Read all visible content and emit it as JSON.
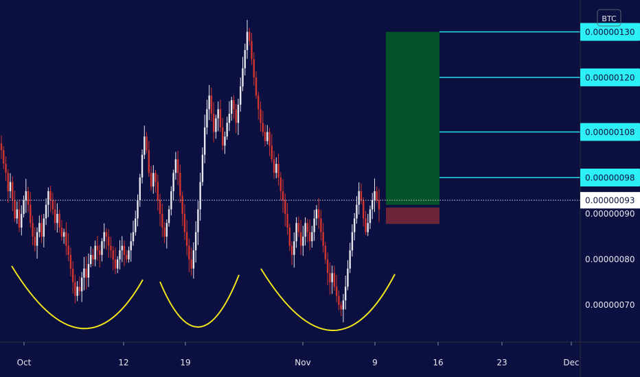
{
  "chart_data": {
    "type": "candlestick",
    "currency": "BTC",
    "y_ticks": [
      "0.00000090",
      "0.00000080",
      "0.00000070"
    ],
    "y_ticks_values": [
      9e-07,
      8e-07,
      7e-07
    ],
    "x_ticks": [
      "Oct",
      "12",
      "19",
      "Nov",
      "9",
      "16",
      "23",
      "Dec"
    ],
    "ylim": [
      6.2e-07,
      1.37e-06
    ],
    "current_price": {
      "label": "0.00000093",
      "value": 9.3e-07
    },
    "targets": [
      {
        "label": "0.00000130",
        "value": 1.3e-06
      },
      {
        "label": "0.00000120",
        "value": 1.2e-06
      },
      {
        "label": "0.00000108",
        "value": 1.08e-06
      },
      {
        "label": "0.00000098",
        "value": 9.8e-07
      }
    ],
    "position": {
      "profit_top": 1.3e-06,
      "entry": 9.2e-07,
      "stop": 8.78e-07
    },
    "colors": {
      "background": "#0b1040",
      "bull": "#e8e8ee",
      "bear": "#d2352f",
      "target_line": "#27e0f0",
      "target_fill": "#2cf0f6",
      "profit_zone": "#04522a",
      "loss_zone": "#6b2438",
      "arc": "#f2e61a",
      "axis_text": "#e6e8f0"
    },
    "closes": [
      1.04e-06,
      1.01e-06,
      9.9e-07,
      9.5e-07,
      9.7e-07,
      9.3e-07,
      8.9e-07,
      9.1e-07,
      8.7e-07,
      9e-07,
      9.3e-07,
      9.5e-07,
      9.2e-07,
      8.8e-07,
      8.5e-07,
      8.3e-07,
      8.6e-07,
      8.8e-07,
      8.5e-07,
      8.9e-07,
      9.2e-07,
      9.5e-07,
      9.3e-07,
      9.1e-07,
      8.8e-07,
      9e-07,
      8.7e-07,
      8.5e-07,
      8.6e-07,
      8.3e-07,
      8.1e-07,
      7.8e-07,
      7.5e-07,
      7.2e-07,
      7.4e-07,
      7.3e-07,
      7.6e-07,
      7.8e-07,
      7.6e-07,
      7.9e-07,
      8.1e-07,
      8e-07,
      8.3e-07,
      8.2e-07,
      8.1e-07,
      8.4e-07,
      8.6e-07,
      8.5e-07,
      8.3e-07,
      8.2e-07,
      8e-07,
      7.8e-07,
      8e-07,
      8.2e-07,
      8.3e-07,
      8.1e-07,
      8e-07,
      8.2e-07,
      8.4e-07,
      8.6e-07,
      8.9e-07,
      9.3e-07,
      9.8e-07,
      1.03e-06,
      1.07e-06,
      1.04e-06,
      9.9e-07,
      9.6e-07,
      9.9e-07,
      9.7e-07,
      9.3e-07,
      9e-07,
      8.7e-07,
      8.5e-07,
      8.8e-07,
      9.1e-07,
      9.5e-07,
      9.9e-07,
      1.02e-06,
      9.9e-07,
      9.4e-07,
      9e-07,
      8.6e-07,
      8.3e-07,
      8e-07,
      7.8e-07,
      8.2e-07,
      8.6e-07,
      9.1e-07,
      9.7e-07,
      1.03e-06,
      1.09e-06,
      1.13e-06,
      1.16e-06,
      1.12e-06,
      1.08e-06,
      1.11e-06,
      1.13e-06,
      1.09e-06,
      1.05e-06,
      1.07e-06,
      1.1e-06,
      1.12e-06,
      1.15e-06,
      1.13e-06,
      1.1e-06,
      1.14e-06,
      1.18e-06,
      1.22e-06,
      1.26e-06,
      1.3e-06,
      1.28e-06,
      1.24e-06,
      1.2e-06,
      1.16e-06,
      1.13e-06,
      1.1e-06,
      1.08e-06,
      1.06e-06,
      1.08e-06,
      1.05e-06,
      1.02e-06,
      9.9e-07,
      1.01e-06,
      9.8e-07,
      9.5e-07,
      9.3e-07,
      9e-07,
      8.7e-07,
      8.3e-07,
      8.1e-07,
      8.4e-07,
      8.8e-07,
      8.6e-07,
      8.3e-07,
      8.5e-07,
      8.8e-07,
      8.6e-07,
      8.4e-07,
      8.6e-07,
      8.9e-07,
      9.1e-07,
      8.9e-07,
      8.6e-07,
      8.3e-07,
      8e-07,
      7.7e-07,
      7.5e-07,
      7.7e-07,
      7.4e-07,
      7.2e-07,
      7e-07,
      6.9e-07,
      7.1e-07,
      7.4e-07,
      7.8e-07,
      8.2e-07,
      8.6e-07,
      8.9e-07,
      9.2e-07,
      9.5e-07,
      9.3e-07,
      8.9e-07,
      8.6e-07,
      8.8e-07,
      9.1e-07,
      9.3e-07,
      9.5e-07,
      9.3e-07,
      9.1e-07
    ]
  }
}
